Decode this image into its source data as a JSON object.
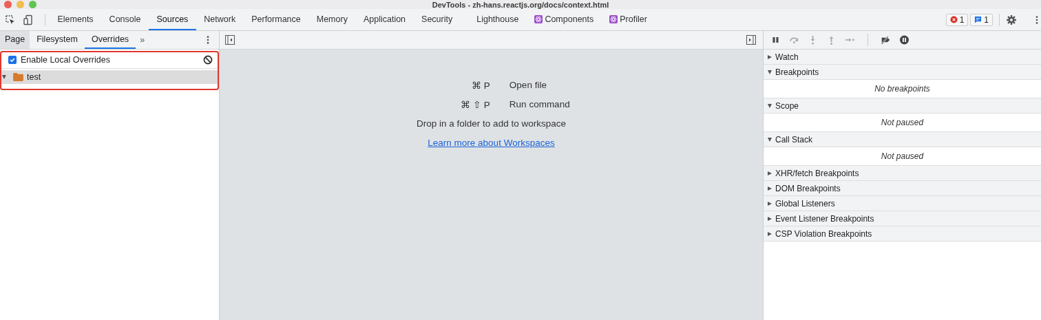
{
  "window": {
    "title": "DevTools - zh-hans.reactjs.org/docs/context.html"
  },
  "tabs": [
    {
      "label": "Elements",
      "selected": false
    },
    {
      "label": "Console",
      "selected": false
    },
    {
      "label": "Sources",
      "selected": true
    },
    {
      "label": "Network",
      "selected": false
    },
    {
      "label": "Performance",
      "selected": false
    },
    {
      "label": "Memory",
      "selected": false
    },
    {
      "label": "Application",
      "selected": false
    },
    {
      "label": "Security",
      "selected": false
    },
    {
      "label": "Lighthouse",
      "selected": false
    },
    {
      "label": "Components",
      "selected": false,
      "kind": "react"
    },
    {
      "label": "Profiler",
      "selected": false,
      "kind": "react"
    }
  ],
  "counters": {
    "errors": "1",
    "messages": "1"
  },
  "navigator": {
    "tabs": [
      {
        "label": "Page",
        "selected": false
      },
      {
        "label": "Filesystem",
        "selected": false
      },
      {
        "label": "Overrides",
        "selected": true
      }
    ],
    "more": "»",
    "enable_overrides": {
      "label": "Enable Local Overrides",
      "checked": true
    },
    "tree": [
      {
        "label": "test",
        "expanded": true,
        "selected": true
      }
    ]
  },
  "editor": {
    "shortcuts": [
      {
        "keys": "⌘ P",
        "action": "Open file"
      },
      {
        "keys": "⌘ ⇧ P",
        "action": "Run command"
      }
    ],
    "hint": "Drop in a folder to add to workspace",
    "link": "Learn more about Workspaces"
  },
  "debugger": {
    "sections": [
      {
        "title": "Watch",
        "expanded": false
      },
      {
        "title": "Breakpoints",
        "expanded": true,
        "message": "No breakpoints"
      },
      {
        "title": "Scope",
        "expanded": true,
        "message": "Not paused"
      },
      {
        "title": "Call Stack",
        "expanded": true,
        "message": "Not paused"
      },
      {
        "title": "XHR/fetch Breakpoints",
        "expanded": false
      },
      {
        "title": "DOM Breakpoints",
        "expanded": false
      },
      {
        "title": "Global Listeners",
        "expanded": false
      },
      {
        "title": "Event Listener Breakpoints",
        "expanded": false
      },
      {
        "title": "CSP Violation Breakpoints",
        "expanded": false
      }
    ]
  }
}
